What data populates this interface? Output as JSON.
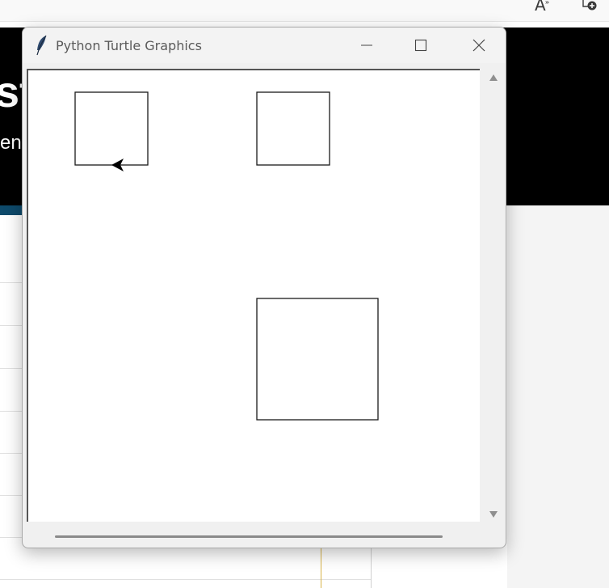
{
  "browser": {
    "read_aloud_icon": "read-aloud-icon",
    "favorites_icon": "add-favorite-icon",
    "hero_title": "st",
    "hero_subtitle": "en"
  },
  "window": {
    "title": "Python Turtle Graphics",
    "app_icon": "feather-icon",
    "controls": [
      "minimize-icon",
      "maximize-icon",
      "close-icon"
    ]
  },
  "canvas": {
    "background": "#ffffff",
    "stroke_color": "#000000",
    "squares": [
      {
        "name": "square-top-left"
      },
      {
        "name": "square-top-right"
      },
      {
        "name": "square-large"
      }
    ],
    "turtle": {
      "heading": "left"
    }
  },
  "colors": {
    "hero_background": "#000000",
    "hero_accent": "#0e4a6b",
    "window_chrome": "#f0f0f0"
  }
}
